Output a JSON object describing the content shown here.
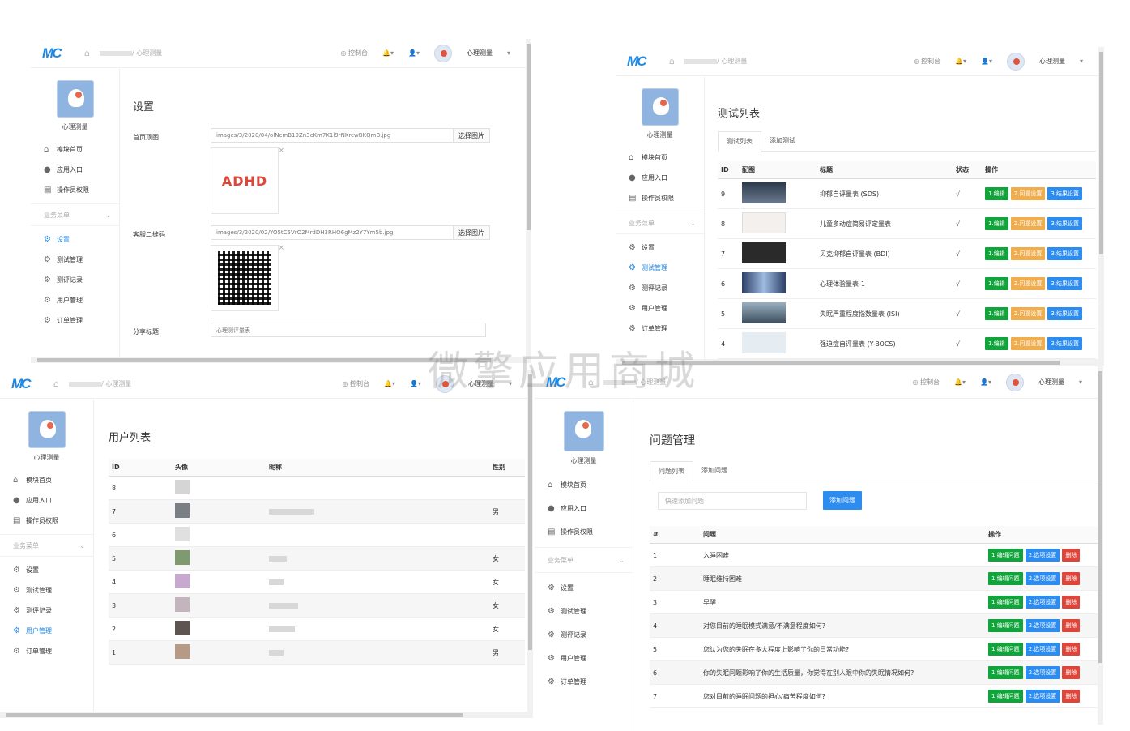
{
  "common": {
    "logo": "MC",
    "breadcrumb_suffix": "/ 心理测量",
    "console": "控制台",
    "username": "心理测量",
    "app_title": "心理测量",
    "menu": [
      {
        "label": "模块首页",
        "icon": "home-icon"
      },
      {
        "label": "应用入口",
        "icon": "chat-icon"
      },
      {
        "label": "操作员权限",
        "icon": "doc-icon"
      }
    ],
    "section_label": "业务菜单",
    "business_menu": [
      "设置",
      "测试管理",
      "测评记录",
      "用户管理",
      "订单管理"
    ]
  },
  "settings": {
    "title": "设置",
    "fields": [
      {
        "label": "首页顶图",
        "value": "images/3/2020/04/olNcmB19Zn3cKm7K1l9rNKrcwBKQmB.jpg",
        "button": "选择图片"
      },
      {
        "label": "客服二维码",
        "value": "images/3/2020/02/YO5tC5VrO2MrdDH3RHO6gMz2Y7Ym5b.jpg",
        "button": "选择图片"
      },
      {
        "label": "分享标题",
        "value": "心理测评量表"
      }
    ],
    "preview_text": "ADHD"
  },
  "tests": {
    "title": "测试列表",
    "tabs": [
      "测试列表",
      "添加测试"
    ],
    "columns": [
      "ID",
      "配图",
      "标题",
      "状态",
      "操作"
    ],
    "rows": [
      {
        "id": "9",
        "title": "抑郁自评量表 (SDS)",
        "status": "√"
      },
      {
        "id": "8",
        "title": "儿童多动症简易评定量表",
        "status": "√"
      },
      {
        "id": "7",
        "title": "贝克抑郁自评量表 (BDI)",
        "status": "√"
      },
      {
        "id": "6",
        "title": "心理体验量表-1",
        "status": "√"
      },
      {
        "id": "5",
        "title": "失眠严重程度指数量表 (ISI)",
        "status": "√"
      },
      {
        "id": "4",
        "title": "强迫症自评量表 (Y-BOCS)",
        "status": "√"
      }
    ],
    "actions": [
      "1.编辑",
      "2.问题设置",
      "3.结果设置"
    ]
  },
  "users": {
    "title": "用户列表",
    "columns": [
      "ID",
      "头像",
      "昵称",
      "性别"
    ],
    "rows": [
      {
        "id": "8",
        "gender": ""
      },
      {
        "id": "7",
        "gender": "男"
      },
      {
        "id": "6",
        "gender": ""
      },
      {
        "id": "5",
        "gender": "女"
      },
      {
        "id": "4",
        "gender": "女"
      },
      {
        "id": "3",
        "gender": "女"
      },
      {
        "id": "2",
        "gender": "女"
      },
      {
        "id": "1",
        "gender": "男"
      }
    ]
  },
  "questions": {
    "title": "问题管理",
    "tabs": [
      "问题列表",
      "添加问题"
    ],
    "quick_placeholder": "快速添加问题",
    "add_button": "添加问题",
    "columns": [
      "#",
      "问题",
      "操作"
    ],
    "rows": [
      {
        "id": "1",
        "q": "入睡困难"
      },
      {
        "id": "2",
        "q": "睡眠维持困难"
      },
      {
        "id": "3",
        "q": "早醒"
      },
      {
        "id": "4",
        "q": "对您目前的睡眠模式满意/不满意程度如何?"
      },
      {
        "id": "5",
        "q": "您认为您的失眠在多大程度上影响了你的日常功能?"
      },
      {
        "id": "6",
        "q": "你的失眠问题影响了你的生活质量，你觉得在别人眼中你的失眠情况如何?"
      },
      {
        "id": "7",
        "q": "您对目前的睡眠问题的担心/痛苦程度如何?"
      }
    ],
    "actions": [
      "1.编辑问题",
      "2.选项设置",
      "删除"
    ]
  },
  "watermark": "微擎应用商城"
}
